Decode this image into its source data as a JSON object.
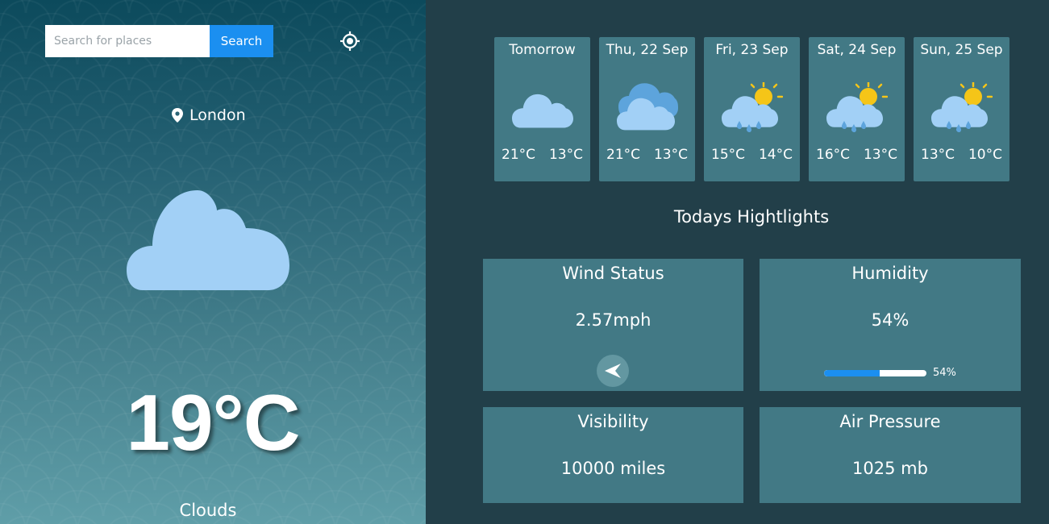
{
  "search": {
    "placeholder": "Search for places",
    "button_label": "Search"
  },
  "current": {
    "location": "London",
    "temperature": "19°C",
    "condition": "Clouds"
  },
  "forecast": [
    {
      "day": "Tomorrow",
      "max": "21°C",
      "min": "13°C",
      "icon": "cloud-icon"
    },
    {
      "day": "Thu, 22 Sep",
      "max": "21°C",
      "min": "13°C",
      "icon": "heavy-clouds-icon"
    },
    {
      "day": "Fri, 23 Sep",
      "max": "15°C",
      "min": "14°C",
      "icon": "sun-cloud-rain-icon"
    },
    {
      "day": "Sat, 24 Sep",
      "max": "16°C",
      "min": "13°C",
      "icon": "sun-cloud-rain-icon"
    },
    {
      "day": "Sun, 25 Sep",
      "max": "13°C",
      "min": "10°C",
      "icon": "sun-cloud-rain-icon"
    }
  ],
  "highlights": {
    "title": "Todays Hightlights",
    "wind": {
      "title": "Wind Status",
      "value": "2.57mph"
    },
    "humidity": {
      "title": "Humidity",
      "value": "54%",
      "percent": 54,
      "bar_label": "54%"
    },
    "visibility": {
      "title": "Visibility",
      "value": "10000 miles"
    },
    "pressure": {
      "title": "Air Pressure",
      "value": "1025 mb"
    }
  },
  "colors": {
    "accent": "#1b8ff0",
    "card": "#427985",
    "panel": "#223f49",
    "cloud": "#a2d0f6",
    "sun": "#f5c518"
  }
}
